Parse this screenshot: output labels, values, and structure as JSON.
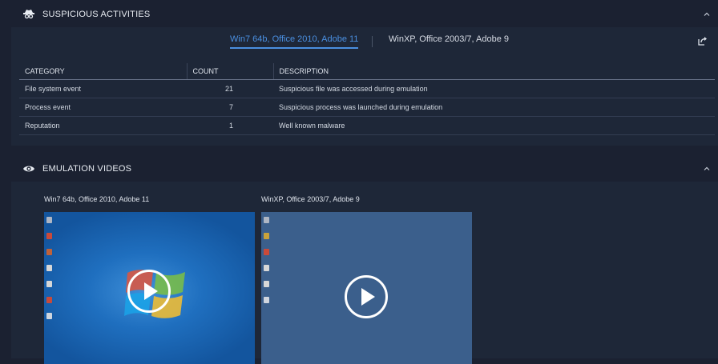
{
  "suspicious": {
    "title": "SUSPICIOUS ACTIVITIES",
    "tabs": [
      {
        "label": "Win7 64b, Office 2010, Adobe 11",
        "active": true
      },
      {
        "label": "WinXP, Office 2003/7, Adobe 9",
        "active": false
      }
    ],
    "table": {
      "headers": [
        "CATEGORY",
        "COUNT",
        "DESCRIPTION"
      ],
      "rows": [
        {
          "category": "File system event",
          "count": "21",
          "description": "Suspicious file was accessed during emulation"
        },
        {
          "category": "Process event",
          "count": "7",
          "description": "Suspicious process was launched during emulation"
        },
        {
          "category": "Reputation",
          "count": "1",
          "description": "Well known malware"
        }
      ]
    }
  },
  "emulation": {
    "title": "EMULATION VIDEOS",
    "videos": [
      {
        "label": "Win7 64b, Office 2010, Adobe 11"
      },
      {
        "label": "WinXP, Office 2003/7, Adobe 9"
      }
    ]
  },
  "icons": {
    "suspicious_header": "spy-icon",
    "emulation_header": "eye-icon",
    "collapse": "chevron-up-icon",
    "export": "external-link-icon",
    "play": "play-icon"
  },
  "colors": {
    "background": "#1b2131",
    "panel": "#1e2738",
    "accent": "#4a8fe0"
  }
}
